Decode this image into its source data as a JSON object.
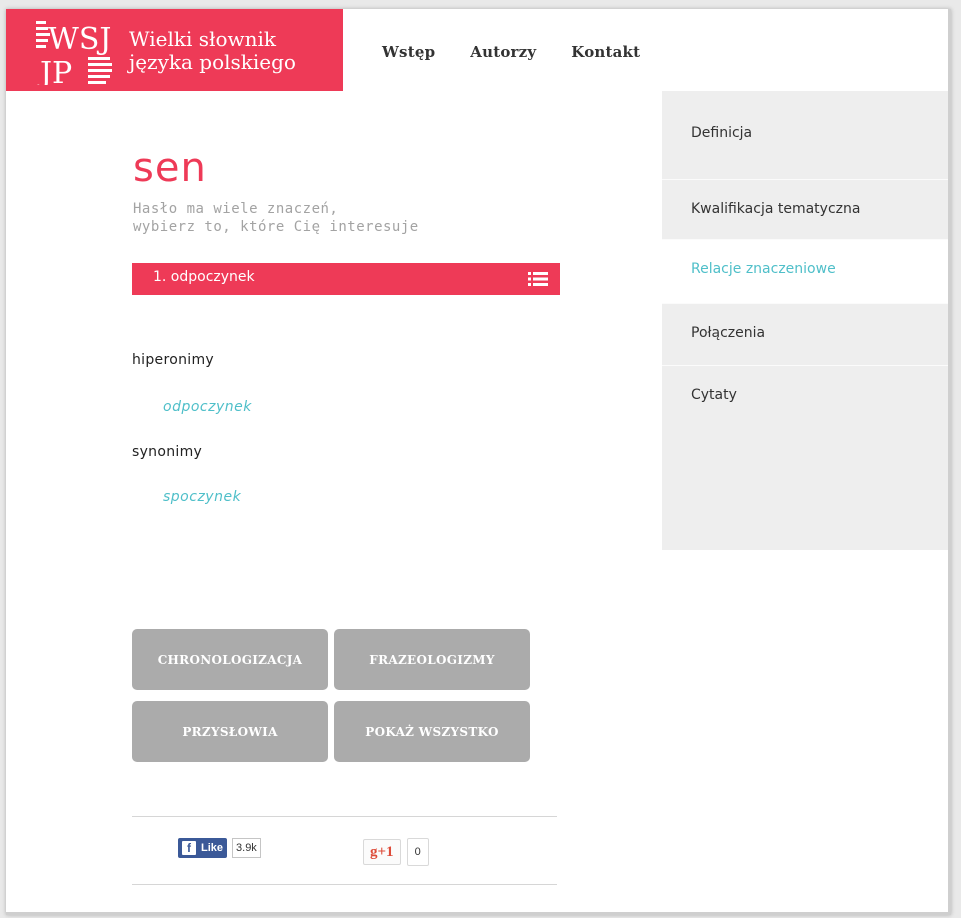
{
  "site": {
    "logo_text": "WSJP",
    "title_line1": "Wielki słownik",
    "title_line2": "języka polskiego",
    "brand_color": "#ee3a57",
    "accent_color": "#4fbfc9"
  },
  "nav": [
    "Wstęp",
    "Autorzy",
    "Kontakt"
  ],
  "entry": {
    "word": "sen",
    "hint_line1": "Hasło ma wiele znaczeń,",
    "hint_line2": "wybierz to, które Cię interesuje",
    "meaning_selected": "1. odpoczynek",
    "meaning_icon": "list-icon"
  },
  "relations": [
    {
      "heading": "hiperonimy",
      "link": "odpoczynek"
    },
    {
      "heading": "synonimy",
      "link": "spoczynek"
    }
  ],
  "buttons": [
    "CHRONOLOGIZACJA",
    "FRAZEOLOGIZMY",
    "PRZYSŁOWIA",
    "POKAŻ WSZYSTKO"
  ],
  "sidebar": [
    {
      "label": "Definicja",
      "active": false
    },
    {
      "label": "Kwalifikacja tematyczna",
      "active": false
    },
    {
      "label": "Relacje znaczeniowe",
      "active": true
    },
    {
      "label": "Połączenia",
      "active": false
    },
    {
      "label": "Cytaty",
      "active": false
    }
  ],
  "social": {
    "fb_icon": "f",
    "fb_label": "Like",
    "fb_count": "3.9k",
    "gplus_label": "g+1",
    "gplus_count": "0"
  }
}
